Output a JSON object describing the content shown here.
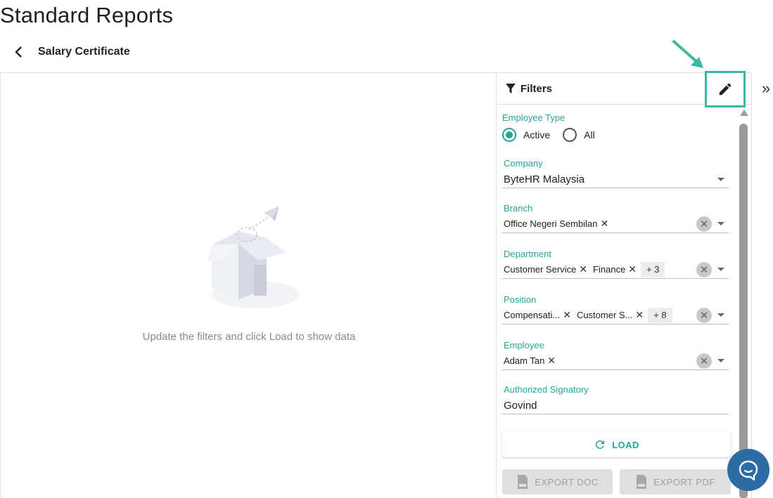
{
  "page": {
    "title": "Standard Reports"
  },
  "report": {
    "name": "Salary Certificate"
  },
  "main": {
    "empty_message": "Update the filters and click Load to show data"
  },
  "filters": {
    "title": "Filters",
    "employee_type": {
      "label": "Employee Type",
      "options": [
        "Active",
        "All"
      ],
      "selected": "Active"
    },
    "company": {
      "label": "Company",
      "value": "ByteHR Malaysia"
    },
    "branch": {
      "label": "Branch",
      "chips": [
        "Office Negeri Sembilan"
      ]
    },
    "department": {
      "label": "Department",
      "chips": [
        "Customer Service",
        "Finance"
      ],
      "more": "+ 3"
    },
    "position": {
      "label": "Position",
      "chips": [
        "Compensati...",
        "Customer S..."
      ],
      "more": "+ 8"
    },
    "employee": {
      "label": "Employee",
      "chips": [
        "Adam Tan"
      ]
    },
    "authorized_signatory": {
      "label": "Authorized Signatory",
      "value": "Govind"
    },
    "load_label": "LOAD",
    "export_doc_label": "EXPORT DOC",
    "export_pdf_label": "EXPORT PDF"
  },
  "colors": {
    "accent": "#26a69a",
    "highlight_box": "#3eb8a4",
    "chat": "#2d6ba3"
  },
  "icons": [
    "chevron-left-icon",
    "filter-icon",
    "pencil-icon",
    "refresh-icon",
    "doc-file-icon",
    "pdf-file-icon",
    "double-chevron-right-icon",
    "chat-icon",
    "arrow-annotation-icon"
  ]
}
